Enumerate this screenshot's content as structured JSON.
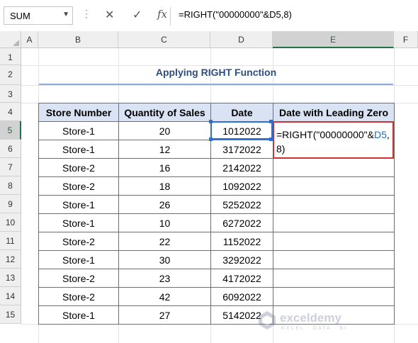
{
  "formula_bar": {
    "name_box": "SUM",
    "cancel_icon": "✕",
    "enter_icon": "✓",
    "fx_label": "fx",
    "formula": "=RIGHT(\"00000000\"&D5,8)"
  },
  "columns": [
    "A",
    "B",
    "C",
    "D",
    "E",
    "F"
  ],
  "rows": [
    "1",
    "2",
    "3",
    "4",
    "5",
    "6",
    "7",
    "8",
    "9",
    "10",
    "11",
    "12",
    "13",
    "14",
    "15"
  ],
  "selected": {
    "column": "E",
    "row": "5"
  },
  "title": "Applying RIGHT Function",
  "table": {
    "headers": [
      "Store Number",
      "Quantity of Sales",
      "Date",
      "Date with Leading Zero"
    ],
    "rows": [
      [
        "Store-1",
        "20",
        "1012022",
        ""
      ],
      [
        "Store-1",
        "12",
        "3172022",
        ""
      ],
      [
        "Store-2",
        "16",
        "2142022",
        ""
      ],
      [
        "Store-2",
        "18",
        "1092022",
        ""
      ],
      [
        "Store-1",
        "26",
        "5252022",
        ""
      ],
      [
        "Store-1",
        "10",
        "6272022",
        ""
      ],
      [
        "Store-2",
        "22",
        "1152022",
        ""
      ],
      [
        "Store-1",
        "30",
        "3292022",
        ""
      ],
      [
        "Store-2",
        "23",
        "4172022",
        ""
      ],
      [
        "Store-2",
        "42",
        "6092022",
        ""
      ],
      [
        "Store-1",
        "27",
        "5142022",
        ""
      ]
    ]
  },
  "editing_cell": {
    "part1": "=RIGHT(\"00000000\"&",
    "ref": "D5",
    "part2": ",",
    "line2": "8)"
  },
  "watermark": {
    "name": "exceldemy",
    "tagline": "EXCEL · DATA · BI"
  },
  "colors": {
    "header_fill": "#dae3f3",
    "title_text": "#2f4e7c",
    "edit_border": "#d32f2f",
    "ref_blue": "#1f6fc5",
    "excel_green": "#217346"
  }
}
